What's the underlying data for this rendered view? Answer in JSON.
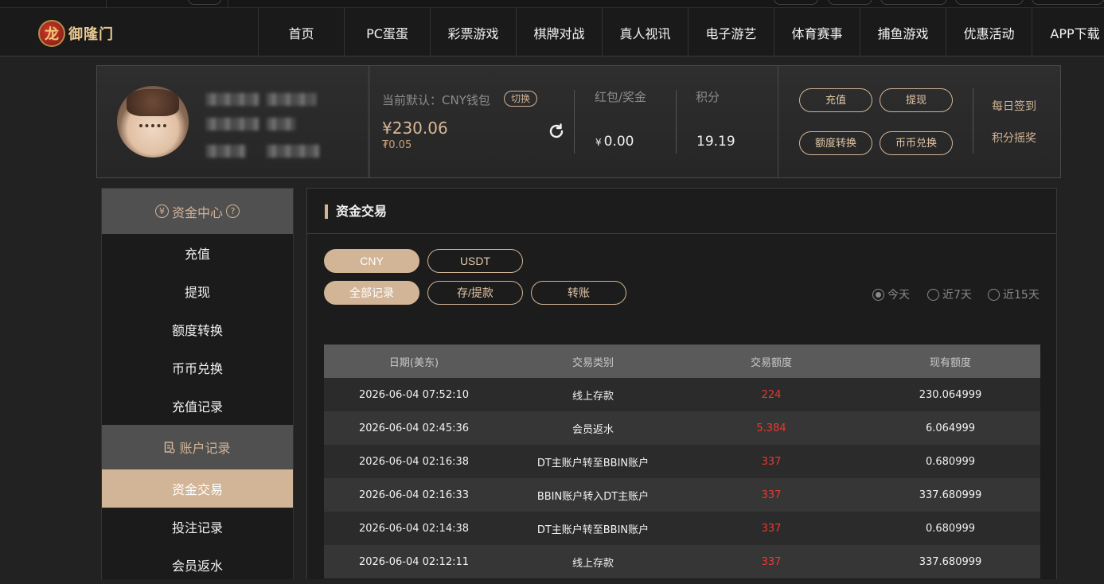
{
  "brand": {
    "logo_text": "御隆门",
    "logo_glyph": "龙"
  },
  "nav": [
    "首页",
    "PC蛋蛋",
    "彩票游戏",
    "棋牌对战",
    "真人视讯",
    "电子游艺",
    "体育赛事",
    "捕鱼游戏",
    "优惠活动",
    "APP下载"
  ],
  "profile": {
    "wallet_label": "当前默认：CNY钱包",
    "switch_label": "切换",
    "balance": "¥230.06",
    "sub_balance": "₮0.05",
    "bonus_label": "红包/奖金",
    "bonus_currency": "¥",
    "bonus_value": "0.00",
    "points_label": "积分",
    "points_value": "19.19",
    "actions": {
      "recharge": "充值",
      "withdraw": "提现",
      "transfer": "额度转换",
      "exchange": "币币兑换"
    },
    "daily_checkin": "每日签到",
    "points_lottery": "积分摇奖"
  },
  "sidebar": {
    "fund_center": "资金中心",
    "fund_items": [
      "充值",
      "提现",
      "额度转换",
      "币币兑换",
      "充值记录"
    ],
    "account_records": "账户记录",
    "record_items": [
      "资金交易",
      "投注记录",
      "会员返水"
    ]
  },
  "main": {
    "title": "资金交易",
    "currency_tabs": [
      "CNY",
      "USDT"
    ],
    "type_tabs": [
      "全部记录",
      "存/提款",
      "转账"
    ],
    "ranges": [
      "今天",
      "近7天",
      "近15天"
    ],
    "table": {
      "headers": [
        "日期(美东)",
        "交易类别",
        "交易额度",
        "现有额度"
      ],
      "rows": [
        [
          "2026-06-04 07:52:10",
          "线上存款",
          "224",
          "230.064999"
        ],
        [
          "2026-06-04 02:45:36",
          "会员返水",
          "5.384",
          "6.064999"
        ],
        [
          "2026-06-04 02:16:38",
          "DT主账户转至BBIN账户",
          "337",
          "0.680999"
        ],
        [
          "2026-06-04 02:16:33",
          "BBIN账户转入DT主账户",
          "337",
          "337.680999"
        ],
        [
          "2026-06-04 02:14:38",
          "DT主账户转至BBIN账户",
          "337",
          "0.680999"
        ],
        [
          "2026-06-04 02:12:11",
          "线上存款",
          "337",
          "337.680999"
        ]
      ]
    }
  },
  "colors": {
    "accent": "#d2b496",
    "amount_red": "#e8392f",
    "bg": "#222222"
  }
}
